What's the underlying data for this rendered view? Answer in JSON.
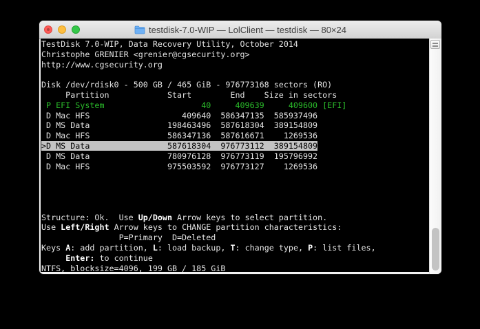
{
  "colors": {
    "term-fg": "#e4e4e4",
    "term-bold": "#ffffff",
    "term-green": "#2bbd2b",
    "sel-bg": "#c3c3c3",
    "sel-fg": "#000000",
    "tl-red": "#fd5b57",
    "tl-red-border": "#e2463f",
    "tl-red-dot": "#b24440",
    "tl-yellow": "#fdbe41",
    "tl-yellow-border": "#dfa023",
    "tl-green": "#35c84a",
    "tl-green-border": "#23a432"
  },
  "window": {
    "title": "testdisk-7.0-WIP — LolClient — testdisk — 80×24",
    "proxy_icon": "folder-icon",
    "grid_size": "80×24"
  },
  "terminal": {
    "app": "TestDisk",
    "lines": [
      {
        "segs": [
          {
            "t": "TestDisk 7.0-WIP, Data Recovery Utility, October 2014",
            "st": "n"
          }
        ]
      },
      {
        "segs": [
          {
            "t": "Christophe GRENIER <grenier@cgsecurity.org>",
            "st": "n"
          }
        ]
      },
      {
        "segs": [
          {
            "t": "http://www.cgsecurity.org",
            "st": "n"
          }
        ]
      },
      {
        "segs": []
      },
      {
        "segs": [
          {
            "t": "Disk /dev/rdisk0 - 500 GB / 465 GiB - 976773168 sectors (RO)",
            "st": "n"
          }
        ]
      },
      {
        "segs": [
          {
            "t": "     Partition            Start        End    Size in sectors",
            "st": "n"
          }
        ]
      },
      {
        "segs": [
          {
            "t": " P EFI System                    40     409639     409600 [EFI]",
            "st": "g"
          }
        ],
        "name": "partition-row-efi-system"
      },
      {
        "segs": [
          {
            "t": " D Mac HFS                   409640  586347135  585937496",
            "st": "n"
          }
        ],
        "name": "partition-row-mac-hfs-1"
      },
      {
        "segs": [
          {
            "t": " D MS Data                198463496  587618304  389154809",
            "st": "n"
          }
        ],
        "name": "partition-row-ms-data-1"
      },
      {
        "segs": [
          {
            "t": " D Mac HFS                586347136  587616671    1269536",
            "st": "n"
          }
        ],
        "name": "partition-row-mac-hfs-2"
      },
      {
        "segs": [
          {
            "t": ">D MS Data                587618304  976773112  389154809",
            "st": "sel"
          }
        ],
        "name": "partition-row-ms-data-selected"
      },
      {
        "segs": [
          {
            "t": " D MS Data                780976128  976773119  195796992",
            "st": "n"
          }
        ],
        "name": "partition-row-ms-data-3"
      },
      {
        "segs": [
          {
            "t": " D Mac HFS                975503592  976773127    1269536",
            "st": "n"
          }
        ],
        "name": "partition-row-mac-hfs-3"
      },
      {
        "segs": []
      },
      {
        "segs": []
      },
      {
        "segs": []
      },
      {
        "segs": []
      },
      {
        "segs": [
          {
            "t": "Structure: Ok.  Use ",
            "st": "n"
          },
          {
            "t": "Up/Down",
            "st": "b"
          },
          {
            "t": " Arrow keys to select partition.",
            "st": "n"
          }
        ]
      },
      {
        "segs": [
          {
            "t": "Use ",
            "st": "n"
          },
          {
            "t": "Left/Right",
            "st": "b"
          },
          {
            "t": " Arrow keys to CHANGE partition characteristics:",
            "st": "n"
          }
        ]
      },
      {
        "segs": [
          {
            "t": "                P=Primary  D=Deleted",
            "st": "n"
          }
        ]
      },
      {
        "segs": [
          {
            "t": "Keys ",
            "st": "n"
          },
          {
            "t": "A",
            "st": "b"
          },
          {
            "t": ": add partition, ",
            "st": "n"
          },
          {
            "t": "L",
            "st": "b"
          },
          {
            "t": ": load backup, ",
            "st": "n"
          },
          {
            "t": "T",
            "st": "b"
          },
          {
            "t": ": change type, ",
            "st": "n"
          },
          {
            "t": "P",
            "st": "b"
          },
          {
            "t": ": list files,",
            "st": "n"
          }
        ]
      },
      {
        "segs": [
          {
            "t": "     ",
            "st": "n"
          },
          {
            "t": "Enter:",
            "st": "b"
          },
          {
            "t": " to continue",
            "st": "n"
          }
        ]
      },
      {
        "segs": [
          {
            "t": "NTFS, blocksize=4096, 199 GB / 185 GiB",
            "st": "n"
          }
        ],
        "name": "status-line-ntfs"
      }
    ]
  }
}
